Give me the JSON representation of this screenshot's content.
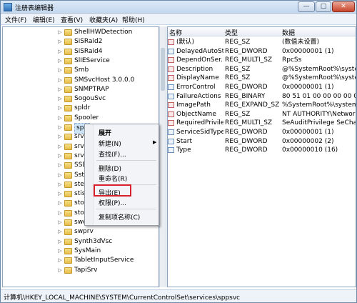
{
  "window": {
    "title": "注册表编辑器",
    "buttons": {
      "minimize": "—",
      "maximize": "□",
      "close": "✕"
    }
  },
  "menubar": [
    "文件(F)",
    "编辑(E)",
    "查看(V)",
    "收藏夹(A)",
    "帮助(H)"
  ],
  "tree": {
    "items": [
      "ShellHWDetection",
      "SiSRaid2",
      "SiSRaid4",
      "SlIEService",
      "Smb",
      "SMSvcHost 3.0.0.0",
      "SNMPTRAP",
      "SogouSvc",
      "spldr",
      "Spooler",
      "spp",
      "srv",
      "srv2",
      "srvn",
      "SSD",
      "Sstp",
      "stex",
      "stisv",
      "stor",
      "stor",
      "swenum",
      "swprv",
      "Synth3dVsc",
      "SysMain",
      "TabletInputService",
      "TapiSrv"
    ],
    "selected_index": 10
  },
  "list": {
    "headers": {
      "name": "名称",
      "type": "类型",
      "data": "数据"
    },
    "rows": [
      {
        "name": "(默认)",
        "type": "REG_SZ",
        "data": "(数值未设置)",
        "kind": "str"
      },
      {
        "name": "DelayedAutoSt...",
        "type": "REG_DWORD",
        "data": "0x00000001 (1)",
        "kind": "bin"
      },
      {
        "name": "DependOnSer...",
        "type": "REG_MULTI_SZ",
        "data": "RpcSs",
        "kind": "str"
      },
      {
        "name": "Description",
        "type": "REG_SZ",
        "data": "@%SystemRoot%\\system3",
        "kind": "str"
      },
      {
        "name": "DisplayName",
        "type": "REG_SZ",
        "data": "@%SystemRoot%\\system3",
        "kind": "str"
      },
      {
        "name": "ErrorControl",
        "type": "REG_DWORD",
        "data": "0x00000001 (1)",
        "kind": "bin"
      },
      {
        "name": "FailureActions",
        "type": "REG_BINARY",
        "data": "80 51 01 00 00 00 00 00 0",
        "kind": "bin"
      },
      {
        "name": "ImagePath",
        "type": "REG_EXPAND_SZ",
        "data": "%SystemRoot%\\system32\\",
        "kind": "str"
      },
      {
        "name": "ObjectName",
        "type": "REG_SZ",
        "data": "NT AUTHORITY\\NetworkS",
        "kind": "str"
      },
      {
        "name": "RequiredPrivile...",
        "type": "REG_MULTI_SZ",
        "data": "SeAuditPrivilege SeChange",
        "kind": "str"
      },
      {
        "name": "ServiceSidType",
        "type": "REG_DWORD",
        "data": "0x00000001 (1)",
        "kind": "bin"
      },
      {
        "name": "Start",
        "type": "REG_DWORD",
        "data": "0x00000002 (2)",
        "kind": "bin"
      },
      {
        "name": "Type",
        "type": "REG_DWORD",
        "data": "0x00000010 (16)",
        "kind": "bin"
      }
    ]
  },
  "context_menu": {
    "items": {
      "expand": "展开",
      "new": "新建(N)",
      "find": "查找(F)...",
      "delete": "删除(D)",
      "rename": "重命名(R)",
      "export": "导出(E)",
      "permissions": "权限(P)...",
      "copy_key_name": "复制项名称(C)"
    },
    "submenu_arrow": "▶",
    "highlighted": "export"
  },
  "statusbar": {
    "path": "计算机\\HKEY_LOCAL_MACHINE\\SYSTEM\\CurrentControlSet\\services\\sppsvc"
  },
  "colors": {
    "highlight": "#d6202b",
    "selection": "#cde4f7",
    "folder": "#e7bd47"
  }
}
